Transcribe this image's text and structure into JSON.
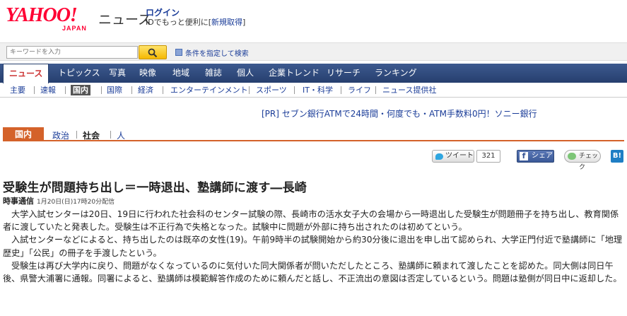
{
  "header": {
    "logo_text": "YAHOO!",
    "logo_sub": "JAPAN",
    "section_name": "ニュース",
    "login_label": "ログイン",
    "login_sub": "IDでもっと便利に[",
    "register_label": "新規取得",
    "register_close": "]"
  },
  "search": {
    "placeholder": "キーワードを入力",
    "conditions_label": "条件を指定して検索"
  },
  "main_nav": [
    {
      "label": "ニュース",
      "active": true
    },
    {
      "label": "トピックス"
    },
    {
      "label": "写真"
    },
    {
      "label": "映像"
    },
    {
      "label": "地域"
    },
    {
      "label": "雑誌"
    },
    {
      "label": "個人"
    },
    {
      "label": "企業トレンド"
    },
    {
      "label": "リサーチ"
    },
    {
      "label": "ランキング"
    }
  ],
  "sub_nav": [
    {
      "label": "主要"
    },
    {
      "label": "速報"
    },
    {
      "label": "国内",
      "active": true
    },
    {
      "label": "国際"
    },
    {
      "label": "経済"
    },
    {
      "label": "エンターテインメント"
    },
    {
      "label": "スポーツ"
    },
    {
      "label": "IT・科学"
    },
    {
      "label": "ライフ"
    },
    {
      "label": "ニュース提供社"
    }
  ],
  "ad_text": "[PR] セブン銀行ATMで24時間・何度でも・ATM手数料0円！ソニー銀行",
  "category_tabs": {
    "active": "国内",
    "items": [
      "政治",
      "社会",
      "人"
    ]
  },
  "social": {
    "tweet_label": "ツイート",
    "tweet_count": "321",
    "share_label": "シェア",
    "check_label": "チェック",
    "hatena_label": "B!"
  },
  "article": {
    "headline": "受験生が問題持ち出し＝一時退出、塾講師に渡す―長崎",
    "source": "時事通信",
    "date": "1月20日(日)17時20分配信",
    "paragraphs": [
      "大学入試センターは20日、19日に行われた社会科のセンター試験の際、長崎市の活水女子大の会場から一時退出した受験生が問題冊子を持ち出し、教育関係者に渡していたと発表した。受験生は不正行為で失格となった。試験中に問題が外部に持ち出されたのは初めてという。",
      "入試センターなどによると、持ち出したのは既卒の女性(19)。午前9時半の試験開始から約30分後に退出を申し出て認められ、大学正門付近で塾講師に「地理歴史」「公民」の冊子を手渡したという。",
      "受験生は再び大学内に戻り、問題がなくなっているのに気付いた同大関係者が問いただしたところ、塾講師に頼まれて渡したことを認めた。同大側は同日午後、県警大浦署に通報。同署によると、塾講師は模範解答作成のために頼んだと話し、不正流出の意図は否定しているという。問題は塾側が同日中に返却した。"
    ]
  },
  "colors": {
    "brand_red": "#ff0033",
    "nav_blue": "#263f6e",
    "link_blue": "#1a3c98",
    "category_orange": "#d4622a"
  }
}
